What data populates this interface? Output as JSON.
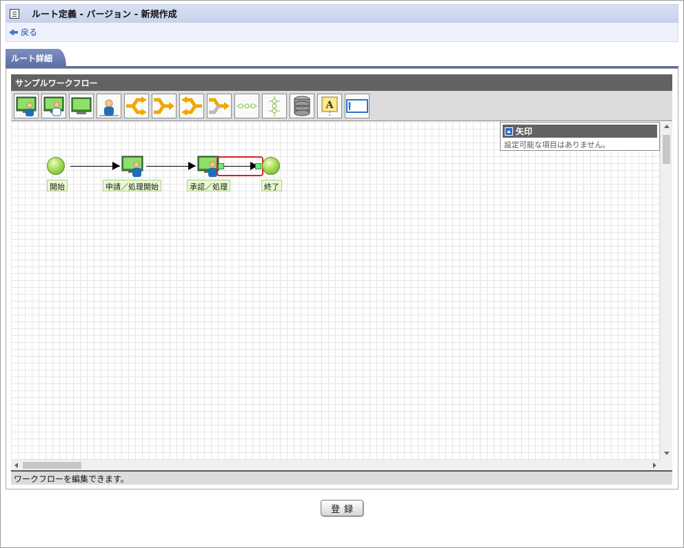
{
  "header": {
    "title": "ルート定義 - バージョン - 新規作成",
    "back_label": "戻る"
  },
  "tab": {
    "label": "ルート詳細"
  },
  "workflow": {
    "name": "サンプルワークフロー",
    "toolbar_tools": [
      "user-task-icon",
      "multi-user-task-icon",
      "system-task-icon",
      "person-icon",
      "split-orange-icon",
      "merge-orange-icon",
      "split-arrow-icon",
      "join-arrow-icon",
      "horizontal-connector-icon",
      "vertical-connector-icon",
      "database-icon",
      "annotation-icon",
      "panel-icon"
    ],
    "nodes": [
      {
        "id": "start",
        "type": "start",
        "label": "開始"
      },
      {
        "id": "apply",
        "type": "task",
        "label": "申請／処理開始"
      },
      {
        "id": "approve",
        "type": "task",
        "label": "承認／処理"
      },
      {
        "id": "end",
        "type": "end",
        "label": "終了"
      }
    ],
    "selected_element": "arrow approve→end",
    "properties": {
      "title": "矢印",
      "message": "設定可能な項目はありません。"
    },
    "status": "ワークフローを編集できます。"
  },
  "actions": {
    "register_label": "登録"
  },
  "colors": {
    "header_bg": "#d0d8ef",
    "tab_bg": "#5c6ea6",
    "panel_header_bg": "#626262",
    "node_green": "#a6dd55",
    "selection_red": "#d62020"
  }
}
